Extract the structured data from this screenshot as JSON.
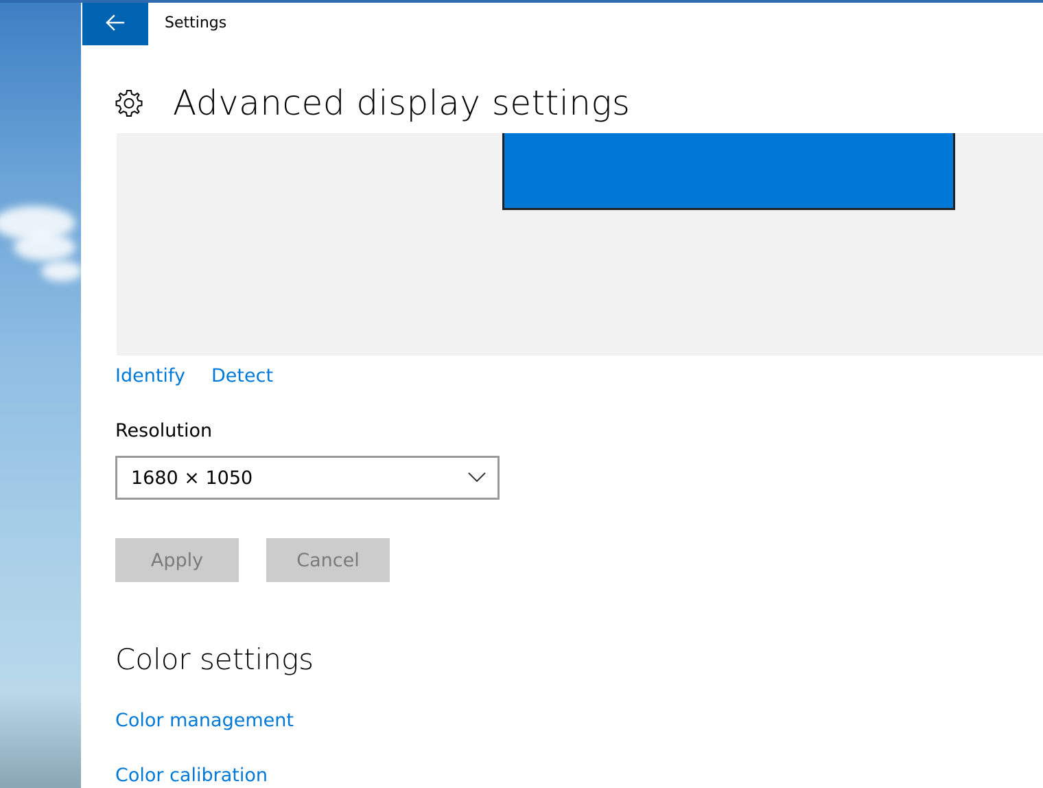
{
  "window": {
    "title": "Settings"
  },
  "header": {
    "title": "Advanced display settings",
    "icon": "gear-icon"
  },
  "display_preview": {
    "monitor_color": "#0078d7"
  },
  "links": {
    "identify": "Identify",
    "detect": "Detect"
  },
  "resolution": {
    "label": "Resolution",
    "value": "1680 × 1050"
  },
  "buttons": {
    "apply": "Apply",
    "cancel": "Cancel"
  },
  "color_settings": {
    "title": "Color settings",
    "management_link": "Color management",
    "calibration_link": "Color calibration"
  },
  "colors": {
    "accent": "#0078d7",
    "back_button_bg": "#0063b1",
    "button_disabled_bg": "#cccccc",
    "preview_bg": "#f2f2f2"
  }
}
